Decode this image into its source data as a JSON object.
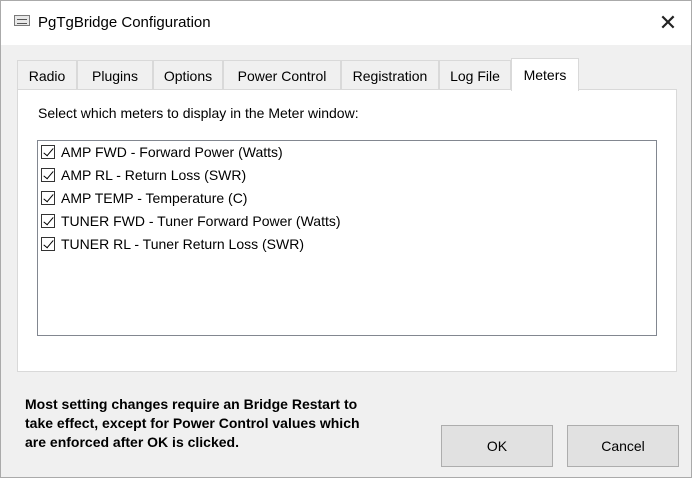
{
  "window": {
    "title": "PgTgBridge Configuration",
    "close_glyph": "✕"
  },
  "tabs": [
    {
      "label": "Radio"
    },
    {
      "label": "Plugins"
    },
    {
      "label": "Options"
    },
    {
      "label": "Power Control"
    },
    {
      "label": "Registration"
    },
    {
      "label": "Log File"
    },
    {
      "label": "Meters",
      "active": true
    }
  ],
  "meters_tab": {
    "instruction": "Select which meters to display in the Meter window:",
    "items": [
      {
        "label": "AMP FWD - Forward Power (Watts)",
        "checked": true
      },
      {
        "label": "AMP RL - Return Loss (SWR)",
        "checked": true
      },
      {
        "label": "AMP TEMP - Temperature (C)",
        "checked": true
      },
      {
        "label": "TUNER FWD - Tuner Forward Power (Watts)",
        "checked": true
      },
      {
        "label": "TUNER RL - Tuner Return Loss (SWR)",
        "checked": true
      }
    ]
  },
  "footer": {
    "note_line1": "Most setting changes require an Bridge Restart to",
    "note_line2": "take effect, except for Power Control values which",
    "note_line3": "are enforced after OK is clicked.",
    "ok_label": "OK",
    "cancel_label": "Cancel"
  }
}
